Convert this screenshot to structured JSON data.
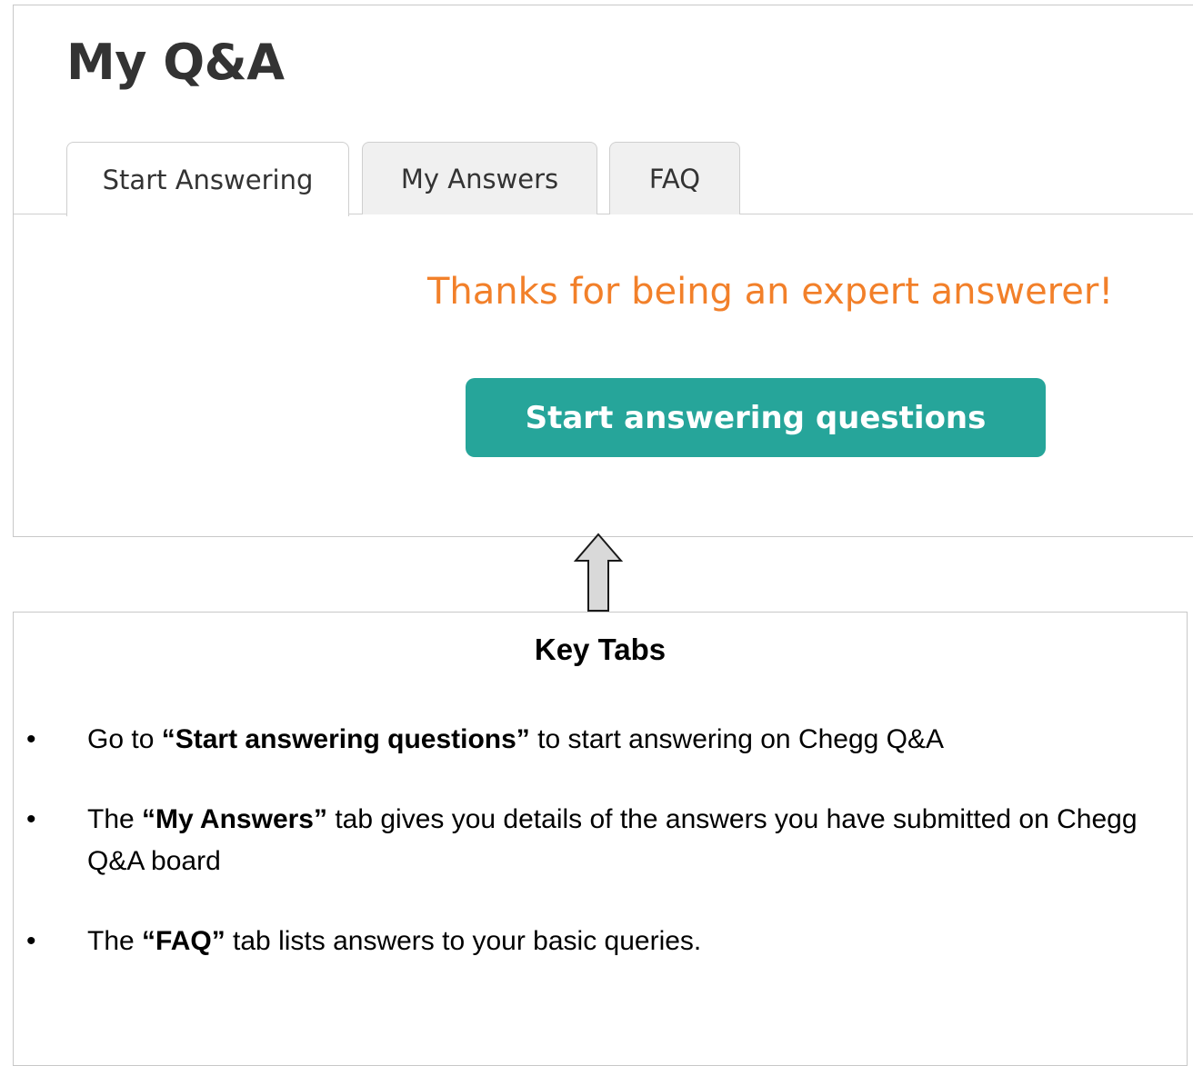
{
  "page": {
    "title": "My Q&A",
    "tabs": [
      {
        "label": "Start Answering",
        "active": true
      },
      {
        "label": "My Answers",
        "active": false
      },
      {
        "label": "FAQ",
        "active": false
      }
    ],
    "message": "Thanks for being an expert answerer!",
    "cta_label": "Start answering questions"
  },
  "callout": {
    "title": "Key Tabs",
    "bullet_char": "•",
    "items": [
      {
        "pre": "Go to ",
        "bold": "“Start answering questions”",
        "post": " to start answering on Chegg Q&A"
      },
      {
        "pre": "The ",
        "bold": "“My Answers”",
        "post": " tab gives you details of the answers you have submitted on Chegg Q&A board"
      },
      {
        "pre": "The ",
        "bold": "“FAQ”",
        "post": " tab lists answers to your basic queries."
      }
    ]
  },
  "icons": {
    "arrow": "up-arrow-icon"
  },
  "colors": {
    "accent": "#26a59a",
    "message": "#f2802a",
    "title": "#333333",
    "border": "#c8c8c8",
    "arrow_fill": "#d9d9d9"
  }
}
